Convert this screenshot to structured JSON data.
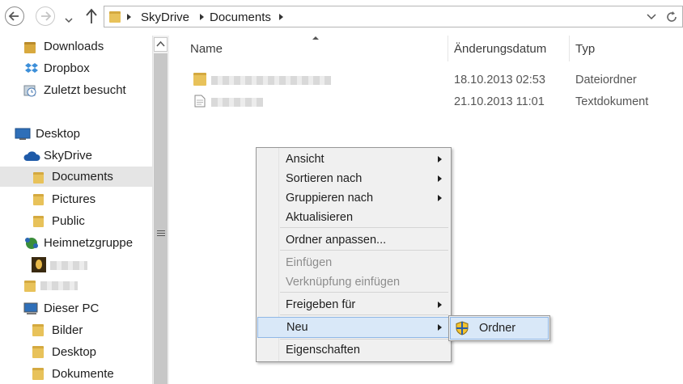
{
  "address_bar": {
    "breadcrumbs": [
      "SkyDrive",
      "Documents"
    ],
    "back_icon": "arrow-left-icon",
    "forward_icon": "arrow-right-icon",
    "up_icon": "arrow-up-icon",
    "refresh_icon": "refresh-icon"
  },
  "nav_pane": {
    "favorites": [
      {
        "label": "Downloads",
        "icon": "downloads-folder-icon"
      },
      {
        "label": "Dropbox",
        "icon": "dropbox-icon"
      },
      {
        "label": "Zuletzt besucht",
        "icon": "recent-places-icon"
      }
    ],
    "desktop": {
      "label": "Desktop",
      "icon": "desktop-icon"
    },
    "skydrive": {
      "label": "SkyDrive",
      "icon": "cloud-icon",
      "children": [
        {
          "label": "Documents",
          "icon": "folder-icon",
          "selected": true
        },
        {
          "label": "Pictures",
          "icon": "folder-icon"
        },
        {
          "label": "Public",
          "icon": "folder-icon"
        }
      ]
    },
    "homegroup": {
      "label": "Heimnetzgruppe",
      "icon": "homegroup-icon"
    },
    "this_pc": {
      "label": "Dieser PC",
      "icon": "computer-icon",
      "children": [
        {
          "label": "Bilder",
          "icon": "pictures-library-icon"
        },
        {
          "label": "Desktop",
          "icon": "desktop-folder-icon"
        },
        {
          "label": "Dokumente",
          "icon": "documents-library-icon"
        }
      ]
    }
  },
  "content": {
    "columns": {
      "name": "Name",
      "date": "Änderungsdatum",
      "type": "Typ"
    },
    "files": [
      {
        "date": "18.10.2013 02:53",
        "type": "Dateiordner",
        "icon": "folder-icon"
      },
      {
        "date": "21.10.2013 11:01",
        "type": "Textdokument",
        "icon": "text-document-icon"
      }
    ]
  },
  "context_menu": {
    "items": [
      {
        "label": "Ansicht",
        "submenu": true
      },
      {
        "label": "Sortieren nach",
        "submenu": true
      },
      {
        "label": "Gruppieren nach",
        "submenu": true
      },
      {
        "label": "Aktualisieren"
      },
      {
        "label": "Ordner anpassen..."
      },
      {
        "label": "Einfügen",
        "disabled": true
      },
      {
        "label": "Verknüpfung einfügen",
        "disabled": true
      },
      {
        "label": "Freigeben für",
        "submenu": true
      },
      {
        "label": "Neu",
        "submenu": true,
        "highlighted": true
      },
      {
        "label": "Eigenschaften"
      }
    ],
    "submenu": {
      "label": "Ordner",
      "icon": "shield-icon"
    }
  },
  "colors": {
    "selection_bg": "#d9e8f8",
    "selection_border": "#8fb7e6",
    "menu_bg": "#f0f0f0",
    "folder": "#e8c25a"
  }
}
